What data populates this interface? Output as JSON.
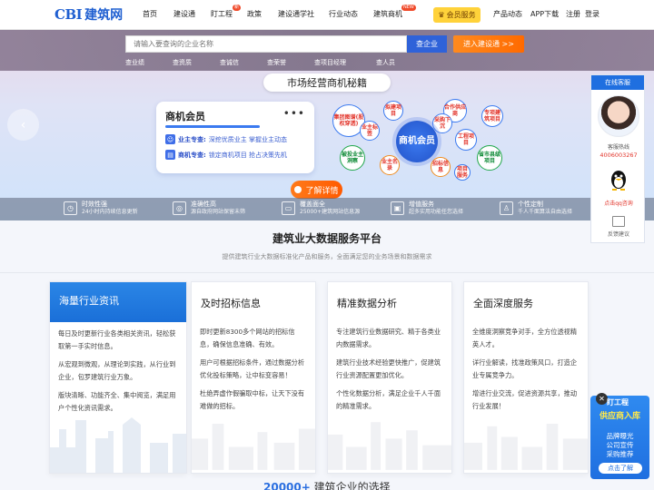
{
  "topnav": {
    "logo_cbi": "CBI",
    "logo_name": "建筑网",
    "items": [
      {
        "label": "首页"
      },
      {
        "label": "建设通"
      },
      {
        "label": "盯工程",
        "badge": "新"
      },
      {
        "label": "政策"
      },
      {
        "label": "建设通学社"
      },
      {
        "label": "行业动态"
      },
      {
        "label": "建筑商机",
        "badge": "NEW"
      },
      {
        "label": "会员服务"
      },
      {
        "label": "产品动态"
      },
      {
        "label": "APP下载"
      },
      {
        "label": "注册"
      },
      {
        "label": "登录"
      }
    ]
  },
  "hero": {
    "search_placeholder": "请输入要查询的企业名称",
    "search_button": "查企业",
    "enter_button": "进入建设通 >>",
    "quick_links": [
      "查业绩",
      "查资质",
      "查诚信",
      "查荣誉",
      "查项目经理",
      "查人员"
    ],
    "banner_title": "市场经营商机秘籍",
    "member_card": {
      "title": "商机会员",
      "dots": "•••",
      "row1_key": "业主专查:",
      "row1_text": "深挖优质业主 掌握业主动态",
      "row2_key": "商机专查:",
      "row2_text": "锁定商机项目 抢占决策先机"
    },
    "bubbles": [
      "集团图谱(股权穿透)",
      "拟建项目",
      "合作供应商",
      "专项建筑项目",
      "业主标签",
      "商机会员",
      "采购下沉",
      "工程项目",
      "被投业主洞察",
      "业主名录",
      "省市县级项目",
      "招标信息",
      "项目服务"
    ],
    "center_bubble": "商机会员",
    "more_button": "了解详情",
    "features": [
      {
        "title": "时效性强",
        "desc": "24小时内持续信息更新",
        "icon": "clock-icon"
      },
      {
        "title": "准确性高",
        "desc": "源自政府网站保留未筛",
        "icon": "target-icon"
      },
      {
        "title": "覆盖面全",
        "desc": "25000+建筑网站信息源",
        "icon": "monitor-icon"
      },
      {
        "title": "增值服务",
        "desc": "超多实用功能任您选择",
        "icon": "gift-icon"
      },
      {
        "title": "个性定制",
        "desc": "千人千面算法自由选择",
        "icon": "user-icon"
      }
    ]
  },
  "section": {
    "title": "建筑业大数据服务平台",
    "subtitle": "提供建筑行业大数据标准化产品和服务，全面满足您的业务场景和数据需求"
  },
  "cards": [
    {
      "title": "海量行业资讯",
      "paragraphs": [
        "每日及时更新行业各类相关资讯，轻松获取第一手实时信息。",
        "从宏观到微观，从理论到实践，从行业到企业，包罗建筑行业万象。",
        "版块清晰、功能齐全、集中阅览，满足用户个性化资讯需求。"
      ]
    },
    {
      "title": "及时招标信息",
      "paragraphs": [
        "即时更新8300多个网站的招标信息，确保信息准确、有效。",
        "用户可根据招标条件，通过数据分析优化投标策略，让中标变容易！",
        "杜绝弄虚作假骗取中标，让天下没有难做的招标。"
      ]
    },
    {
      "title": "精准数据分析",
      "paragraphs": [
        "专注建筑行业数据研究、精于各类业内数据需求。",
        "建筑行业技术经验更快推广，促建筑行业资源配置更加优化。",
        "个性化数据分析，满足企业千人千面的精准需求。"
      ]
    },
    {
      "title": "全面深度服务",
      "paragraphs": [
        "全维度洞察竞争对手，全方位透视精英人才。",
        "详行业解读，找准政策风口，打造企业专属竞争力。",
        "增进行业交流，促进资源共享，推动行业发展！"
      ]
    }
  ],
  "bottom_cta": {
    "number": "20000+",
    "text": "建筑企业的选择"
  },
  "side_panel": {
    "title": "在线客服",
    "hotline_label": "客服热线",
    "hotline": "4006003267",
    "qq_label": "点击qq咨询",
    "feedback_label": "反馈建议"
  },
  "promo": {
    "close": "✕",
    "brand": "盯工程",
    "headline": "供应商入库",
    "line1": "品牌曝光",
    "line2": "公司宣传",
    "line3": "采购推荐",
    "button": "点击了解"
  },
  "colors": {
    "brand_blue": "#1f5fd1",
    "accent_orange": "#ff6a00",
    "card_active": "#1a6fd8",
    "alert_red": "#e2342a"
  }
}
